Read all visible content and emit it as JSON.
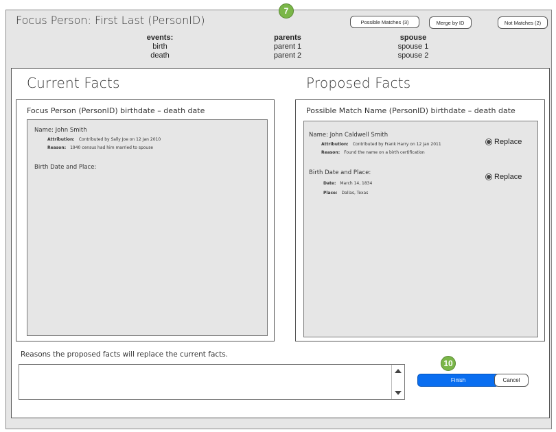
{
  "header": {
    "title": "Focus Person: First Last (PersonID)",
    "badge_top": "7",
    "buttons": {
      "possible_matches": "Possible Matches (3)",
      "merge_by_id": "Merge by ID",
      "not_matches": "Not Matches (2)"
    },
    "columns": [
      {
        "title": "events:",
        "items": [
          "birth",
          "death"
        ]
      },
      {
        "title": "parents",
        "items": [
          "parent 1",
          "parent 2"
        ]
      },
      {
        "title": "spouse",
        "items": [
          "spouse 1",
          "spouse 2"
        ]
      }
    ]
  },
  "current": {
    "section_title": "Current Facts",
    "panel_header": "Focus Person (PersonID)   birthdate – death date",
    "name_line": "Name: John Smith",
    "attribution_label": "Attribution:",
    "attribution_value": "Contributed by Sally Joe on 12 Jan 2010",
    "reason_label": "Reason:",
    "reason_value": "1940 census had him married to spouse",
    "birth_heading": "Birth Date and Place:"
  },
  "proposed": {
    "section_title": "Proposed Facts",
    "panel_header": "Possible Match Name (PersonID) birthdate – death date",
    "name_line": "Name: John Caldwell Smith",
    "attribution_label": "Attribution:",
    "attribution_value": "Contributed by Frank Harry on 12 Jan 2011",
    "reason_label": "Reason:",
    "reason_value": "Found the name on a birth certification",
    "birth_heading": "Birth Date and Place:",
    "date_label": "Date:",
    "date_value": "March 14, 1834",
    "place_label": "Place:",
    "place_value": "Dallas, Texas",
    "replace_label_1": "Replace",
    "replace_label_2": "Replace"
  },
  "footer": {
    "reasons_label": "Reasons the proposed facts will replace the current facts.",
    "reasons_value": "",
    "badge_bottom": "10",
    "finish_label": "Finish",
    "cancel_label": "Cancel"
  },
  "colors": {
    "finish_blue": "#0a6ef0",
    "badge_green": "#7ab648",
    "frame_gray": "#e6e6e6"
  }
}
